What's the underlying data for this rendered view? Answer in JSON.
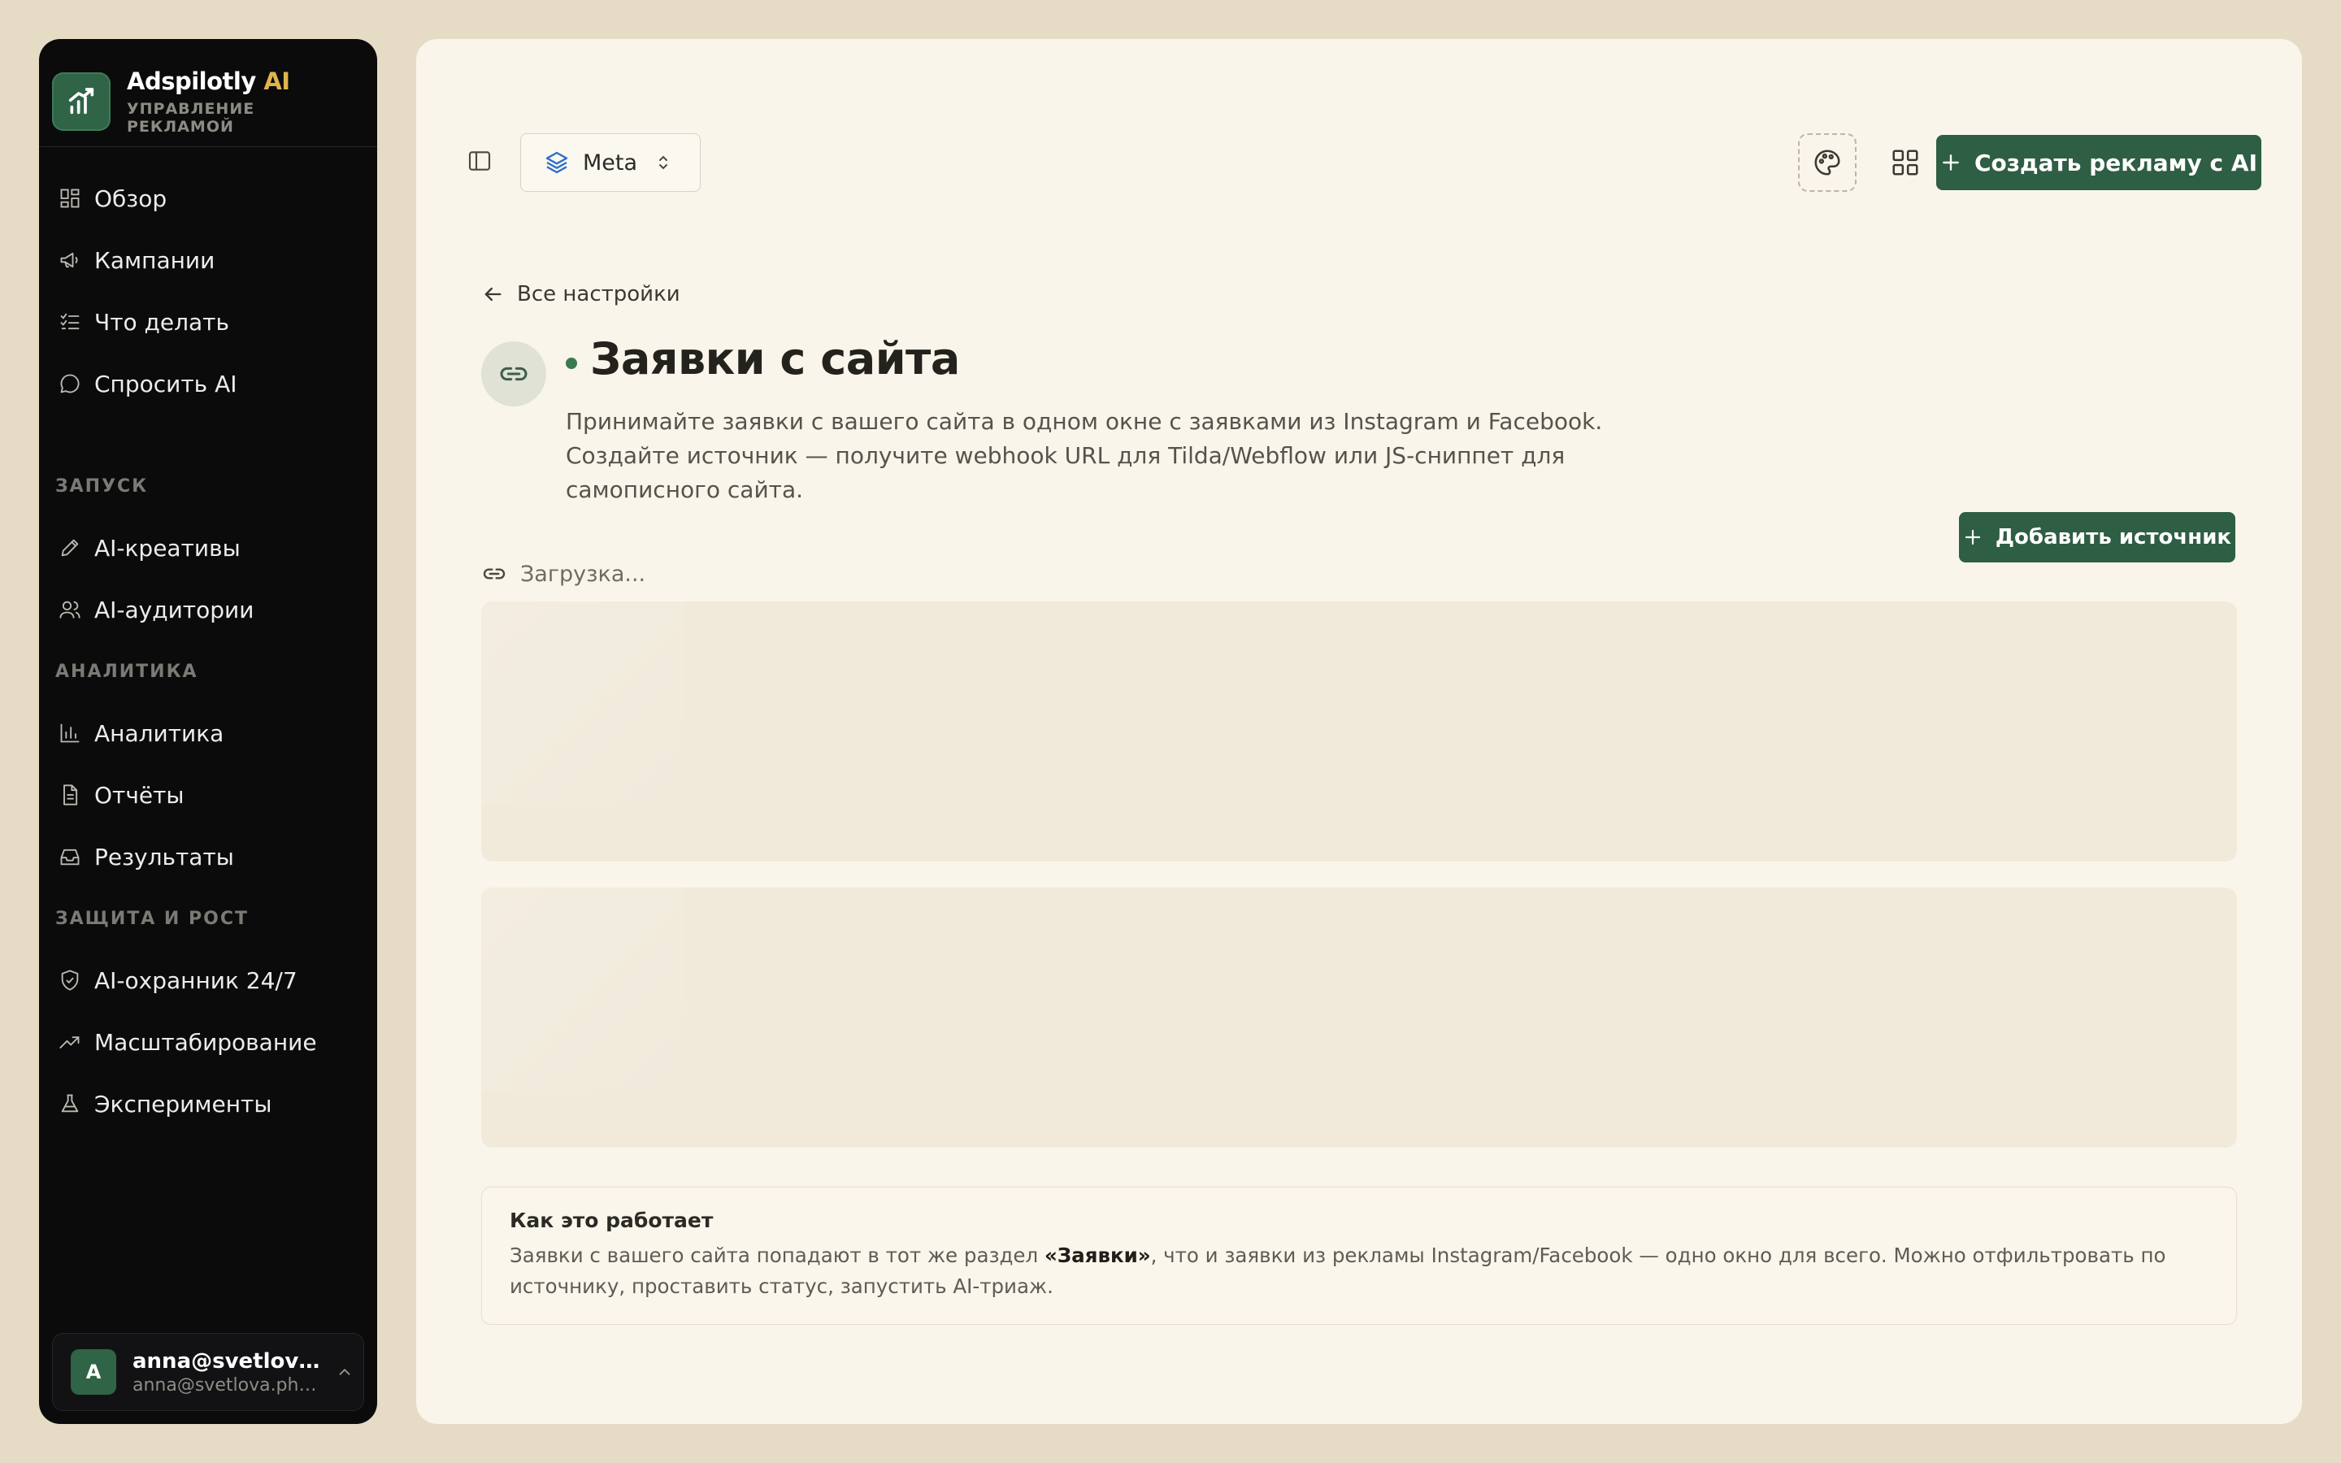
{
  "sidebar": {
    "brand": {
      "name": "Adspilotly",
      "name_ai": "AI",
      "subtitle": "УПРАВЛЕНИЕ РЕКЛАМОЙ"
    },
    "items": [
      {
        "label": "Обзор",
        "icon": "dashboard-icon"
      },
      {
        "label": "Кампании",
        "icon": "megaphone-icon"
      },
      {
        "label": "Что делать",
        "icon": "checklist-icon"
      },
      {
        "label": "Спросить AI",
        "icon": "chat-icon"
      }
    ],
    "sections": [
      {
        "title": "ЗАПУСК",
        "items": [
          {
            "label": "AI-креативы",
            "icon": "pen-icon"
          },
          {
            "label": "AI-аудитории",
            "icon": "users-icon"
          }
        ]
      },
      {
        "title": "АНАЛИТИКА",
        "items": [
          {
            "label": "Аналитика",
            "icon": "bar-chart-icon"
          },
          {
            "label": "Отчёты",
            "icon": "document-icon"
          },
          {
            "label": "Результаты",
            "icon": "inbox-icon"
          }
        ]
      },
      {
        "title": "ЗАЩИТА И РОСТ",
        "items": [
          {
            "label": "AI-охранник 24/7",
            "icon": "shield-icon"
          },
          {
            "label": "Масштабирование",
            "icon": "trending-up-icon"
          },
          {
            "label": "Эксперименты",
            "icon": "flask-icon"
          }
        ]
      }
    ],
    "user": {
      "initial": "A",
      "name": "anna@svetlova.photo",
      "email": "anna@svetlova.photo"
    }
  },
  "header": {
    "platform": "Meta",
    "create_button": "Создать рекламу с AI"
  },
  "page": {
    "back_label": "Все настройки",
    "title": "Заявки с сайта",
    "description": "Принимайте заявки с вашего сайта в одном окне с заявками из Instagram и Facebook. Создайте источник — получите webhook URL для Tilda/Webflow или JS-сниппет для самописного сайта.",
    "loading": "Загрузка...",
    "add_button": "Добавить источник"
  },
  "info": {
    "title": "Как это работает",
    "text_before": "Заявки с вашего сайта попадают в тот же раздел ",
    "text_bold": "«Заявки»",
    "text_after": ", что и заявки из рекламы Instagram/Facebook — одно окно для всего. Можно отфильтровать по источнику, проставить статус, запустить AI-триаж."
  },
  "colors": {
    "accent": "#2e5e43",
    "brand_ai": "#e0b44c",
    "sidebar_bg": "#0b0b0c",
    "page_bg": "#f9f5ea"
  }
}
